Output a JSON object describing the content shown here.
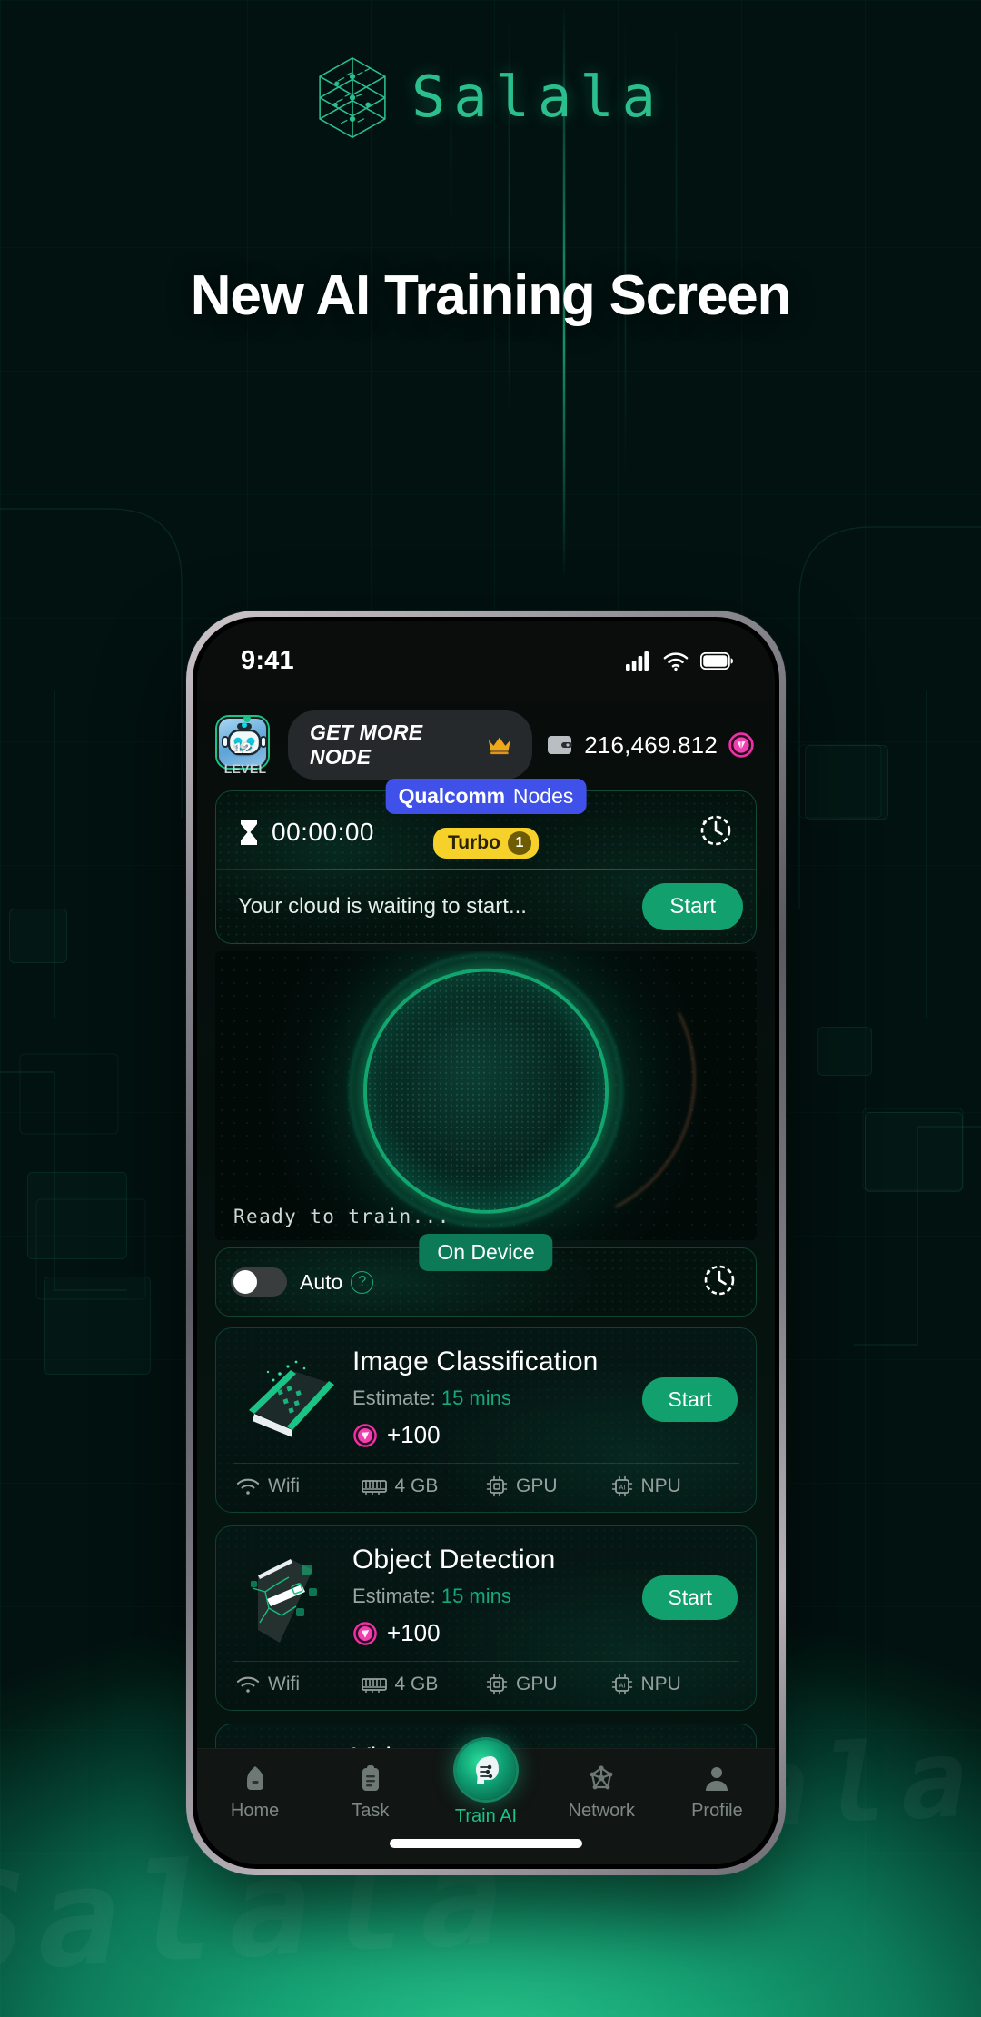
{
  "poster": {
    "brand_name": "Salala",
    "brand_mark_icon": "cube-network-logo-icon",
    "headline": "New AI Training Screen",
    "watermark_text": "Salala"
  },
  "phone": {
    "statusbar": {
      "time": "9:41",
      "cellular_icon": "signal-bars-icon",
      "wifi_icon": "wifi-icon",
      "battery_icon": "battery-full-icon"
    },
    "topbar": {
      "level_number": "12",
      "level_word": "LEVEL",
      "avatar_icon": "robot-avatar-icon",
      "get_more_node_label": "GET MORE NODE",
      "crown_icon": "crown-icon",
      "wallet_icon": "wallet-icon",
      "wallet_amount": "216,469.812",
      "token_icon": "token-coin-icon"
    },
    "node_panel": {
      "hourglass_icon": "hourglass-icon",
      "timer": "00:00:00",
      "qualcomm_label": "Qualcomm",
      "nodes_label": "Nodes",
      "turbo_label": "Turbo",
      "turbo_count": "1",
      "history_icon": "history-clock-icon",
      "cloud_status": "Your cloud is waiting to start...",
      "start_label": "Start"
    },
    "orb": {
      "status_text": "Ready to train...",
      "orb_icon": "training-sphere-icon"
    },
    "device_row": {
      "auto_label": "Auto",
      "auto_toggle_state": "off",
      "help_icon": "question-mark-icon",
      "on_device_label": "On Device",
      "history_icon": "history-clock-icon"
    },
    "tasks": [
      {
        "title": "Image Classification",
        "thumb_icon": "image-classification-icon",
        "estimate_label": "Estimate:",
        "estimate_value": "15 mins",
        "reward_icon": "token-coin-icon",
        "reward": "+100",
        "start_label": "Start",
        "specs": [
          {
            "icon": "wifi-icon",
            "label": "Wifi"
          },
          {
            "icon": "ram-icon",
            "label": "4 GB"
          },
          {
            "icon": "gpu-chip-icon",
            "label": "GPU"
          },
          {
            "icon": "npu-chip-icon",
            "label": "NPU"
          }
        ]
      },
      {
        "title": "Object Detection",
        "thumb_icon": "object-detection-icon",
        "estimate_label": "Estimate:",
        "estimate_value": "15 mins",
        "reward_icon": "token-coin-icon",
        "reward": "+100",
        "start_label": "Start",
        "specs": [
          {
            "icon": "wifi-icon",
            "label": "Wifi"
          },
          {
            "icon": "ram-icon",
            "label": "4 GB"
          },
          {
            "icon": "gpu-chip-icon",
            "label": "GPU"
          },
          {
            "icon": "npu-chip-icon",
            "label": "NPU"
          }
        ]
      },
      {
        "title": "Video",
        "thumb_icon": "video-task-icon",
        "estimate_label": "",
        "estimate_value": "",
        "reward_icon": "",
        "reward": "",
        "start_label": "",
        "specs": []
      }
    ],
    "bottom_nav": [
      {
        "label": "Home",
        "icon": "home-icon",
        "active": false
      },
      {
        "label": "Task",
        "icon": "clipboard-icon",
        "active": false
      },
      {
        "label": "Train AI",
        "icon": "ai-head-icon",
        "active": true
      },
      {
        "label": "Network",
        "icon": "network-nodes-icon",
        "active": false
      },
      {
        "label": "Profile",
        "icon": "person-icon",
        "active": false
      }
    ]
  },
  "colors": {
    "brand_green": "#2bbf8d",
    "accent_green": "#12a06e",
    "qualcomm_blue": "#3f51e8",
    "turbo_yellow": "#f5d129",
    "token_pink": "#ef2fa8",
    "crown_gold": "#f0a81b"
  }
}
